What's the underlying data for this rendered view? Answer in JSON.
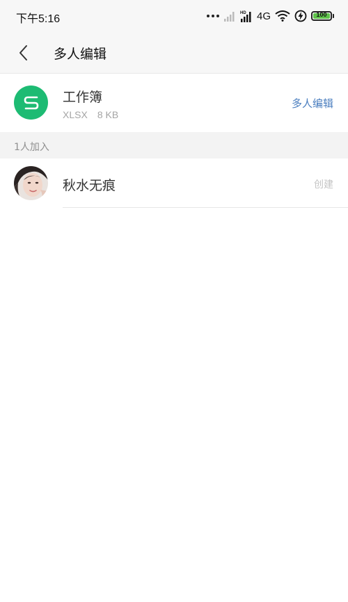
{
  "status_bar": {
    "time": "下午5:16",
    "network": "4G",
    "battery": 100,
    "battery_label": "100"
  },
  "nav": {
    "title": "多人编辑"
  },
  "file": {
    "name": "工作簿",
    "format": "XLSX",
    "size": "8 KB",
    "action_label": "多人编辑",
    "icon_color": "#1dbb73"
  },
  "members": {
    "header": "1人加入",
    "list": [
      {
        "name": "秋水无痕",
        "role": "创建"
      }
    ]
  },
  "colors": {
    "accent": "#4a7ebf",
    "file_icon": "#1dbb73",
    "battery": "#5ec24a"
  }
}
